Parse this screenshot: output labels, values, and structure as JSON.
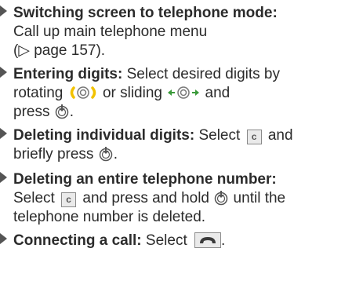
{
  "items": [
    {
      "heading": "Switching screen to telephone mode:",
      "line2": "Call up main telephone menu",
      "line3": "(▷ page 157)."
    },
    {
      "heading": "Entering digits:",
      "l1_rest": " Select desired digits by",
      "l2_a": "rotating ",
      "l2_b": " or sliding ",
      "l2_c": " and",
      "l3_a": "press ",
      "l3_b": "."
    },
    {
      "heading": "Deleting individual digits:",
      "l1_a": " Select ",
      "l1_b": " and",
      "l2_a": "briefly press ",
      "l2_b": "."
    },
    {
      "heading": "Deleting an entire telephone number:",
      "l2_a": "Select ",
      "l2_b": " and press and hold ",
      "l2_c": " until the",
      "l3": "telephone number is deleted."
    },
    {
      "heading": "Connecting a call:",
      "l1_a": " Select ",
      "l1_b": "."
    }
  ],
  "key_c": "c",
  "icons": {
    "bullet": "triangle-bullet-icon",
    "rotate": "rotate-controller-icon",
    "slide": "slide-controller-icon",
    "press": "press-controller-icon",
    "delete_key": "c-key-icon",
    "call_key": "phone-handset-icon"
  },
  "colors": {
    "text": "#2b2b2b",
    "rotate_accent": "#f2c200",
    "slide_accent": "#3a9a3a",
    "key_bg": "#eaeaea"
  }
}
